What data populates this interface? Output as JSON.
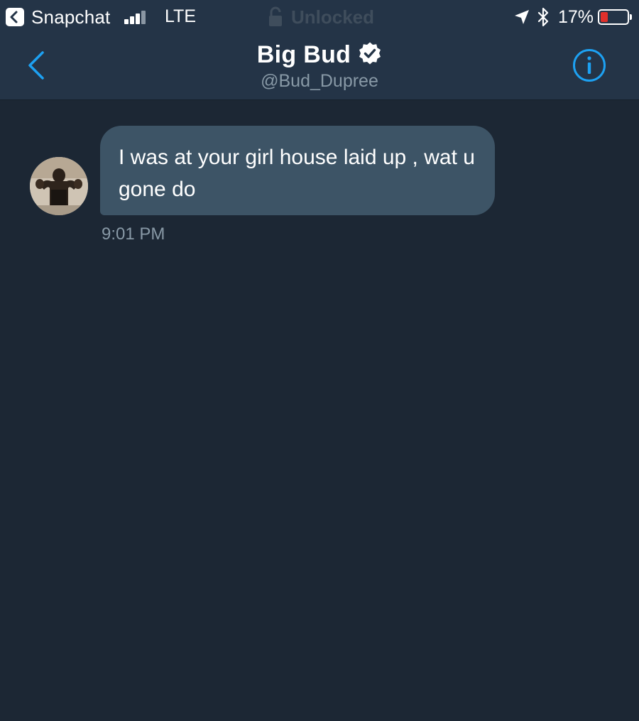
{
  "status_bar": {
    "back_app_label": "Snapchat",
    "network": "LTE",
    "lock_text": "Unlocked",
    "battery_percent": "17%",
    "battery_level": 0.17,
    "icons": [
      "back-app-icon",
      "signal-bars-icon",
      "lock-icon",
      "location-arrow-icon",
      "bluetooth-icon",
      "battery-icon"
    ]
  },
  "header": {
    "title": "Big Bud",
    "handle": "@Bud_Dupree",
    "verified": true,
    "icons": [
      "back-chevron-icon",
      "verified-badge-icon",
      "info-icon"
    ]
  },
  "conversation": {
    "messages": [
      {
        "sender": "incoming",
        "text": "I was at your girl house laid up , wat u gone do",
        "time": "9:01 PM"
      }
    ]
  },
  "colors": {
    "background": "#1c2734",
    "header_background": "#243447",
    "bubble": "#3d5466",
    "accent": "#1da1f2",
    "muted_text": "#8899a6",
    "battery_low": "#e0302b"
  }
}
